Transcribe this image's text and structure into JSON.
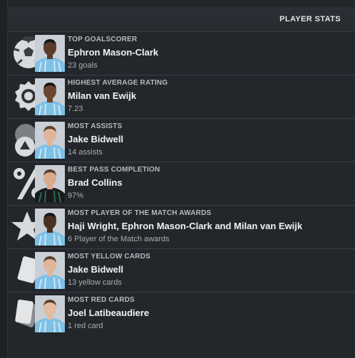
{
  "header": {
    "title": "PLAYER STATS"
  },
  "colors": {
    "background": "#23262b",
    "divider": "#3a3d43",
    "kit_sky_blue": "#7fc0e6",
    "kit_dark": "#1a1a1a"
  },
  "rows": [
    {
      "icon": "football-icon",
      "label": "TOP GOALSCORER",
      "name": "Ephron Mason-Clark",
      "value": "23 goals",
      "skin": "#5a3a2a",
      "kit": "sky"
    },
    {
      "icon": "rosette-icon",
      "label": "HIGHEST AVERAGE RATING",
      "name": "Milan van Ewijk",
      "value": "7.23",
      "skin": "#6b4530",
      "kit": "sky"
    },
    {
      "icon": "assist-icon",
      "label": "MOST ASSISTS",
      "name": "Jake Bidwell",
      "value": "14 assists",
      "skin": "#e0b59a",
      "kit": "sky"
    },
    {
      "icon": "percent-icon",
      "label": "BEST PASS COMPLETION",
      "name": "Brad Collins",
      "value": "97%",
      "skin": "#d9a98c",
      "kit": "dark"
    },
    {
      "icon": "star-icon",
      "label": "MOST PLAYER OF THE MATCH AWARDS",
      "name": "Haji Wright, Ephron Mason-Clark and Milan van Ewijk",
      "value": "6 Player of the Match awards",
      "skin": "#4a3022",
      "kit": "sky"
    },
    {
      "icon": "yellow-card-icon",
      "label": "MOST YELLOW CARDS",
      "name": "Jake Bidwell",
      "value": "13 yellow cards",
      "skin": "#e0b59a",
      "kit": "sky"
    },
    {
      "icon": "red-card-icon",
      "label": "MOST RED CARDS",
      "name": "Joel Latibeaudiere",
      "value": "1 red card",
      "skin": "#e3bca2",
      "kit": "sky"
    }
  ]
}
